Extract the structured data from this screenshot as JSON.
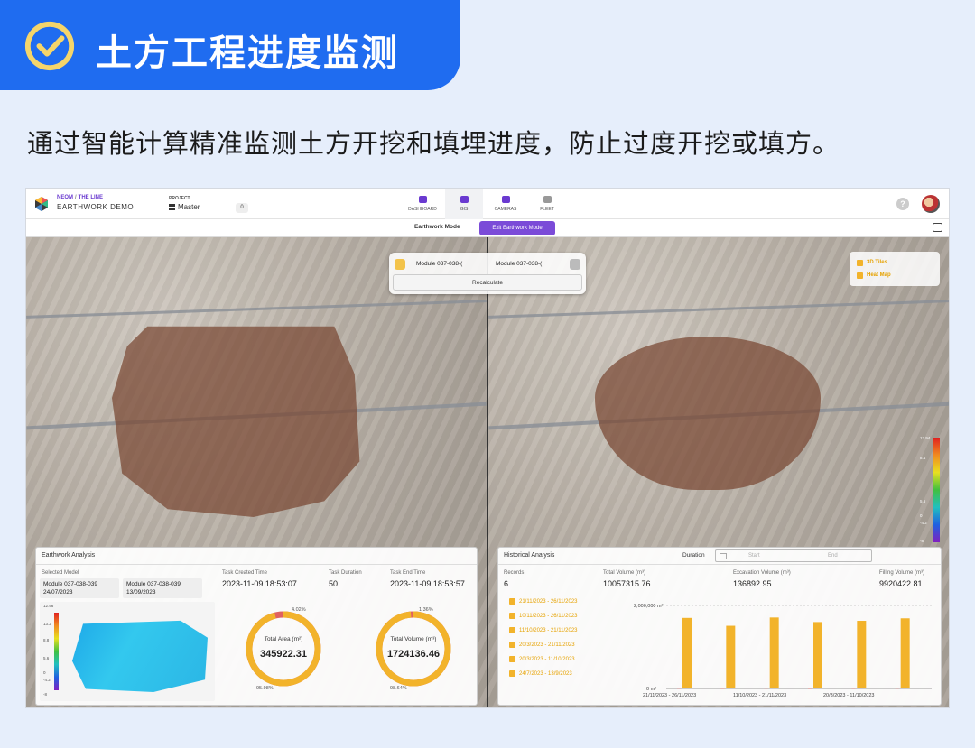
{
  "banner": {
    "title": "土方工程进度监测"
  },
  "subtitle": "通过智能计算精准监测土方开挖和填埋进度，防止过度开挖或填方。",
  "header": {
    "org": "NEOM",
    "sep": "/",
    "project_line": "THE LINE",
    "app": "EARTHWORK DEMO",
    "project_label": "PROJECT",
    "project_value": "Master",
    "project_count": "0",
    "nav": [
      {
        "label": "DASHBOARD"
      },
      {
        "label": "GIS"
      },
      {
        "label": "CAMERAS"
      },
      {
        "label": "FLEET"
      }
    ],
    "help": "?"
  },
  "modebar": {
    "label": "Earthwork Mode",
    "exit": "Exit Earthwork Mode"
  },
  "map": {
    "select_a": "Module 037-038-(",
    "select_b": "Module 037-038-(",
    "recalculate": "Recalculate",
    "layers": [
      {
        "label": "3D Tiles"
      },
      {
        "label": "Heat Map"
      }
    ],
    "legend_ticks": [
      "13.94",
      "8.4",
      "5.6",
      "0",
      "-4.2",
      "-8"
    ]
  },
  "analysis": {
    "title": "Earthwork Analysis",
    "selected_label": "Selected Model",
    "model_a": {
      "name": "Module 037-038-039",
      "date": "24/07/2023"
    },
    "model_b": {
      "name": "Module 037-038-039",
      "date": "13/09/2023"
    },
    "task_created_label": "Task Created Time",
    "task_created": "2023-11-09 18:53:07",
    "task_duration_label": "Task Duration",
    "task_duration": "50",
    "task_end_label": "Task End Time",
    "task_end": "2023-11-09 18:53:57",
    "thumb_ticks": [
      "12.96",
      "13.2",
      "8.8",
      "5.6",
      "0",
      "-4.2",
      "-8"
    ],
    "area": {
      "label": "Total Area (m²)",
      "value": "345922.31",
      "pct_top": "4.02%",
      "pct_bottom": "95.98%",
      "fraction": 0.9598
    },
    "volume": {
      "label": "Total Volume (m³)",
      "value": "1724136.46",
      "pct_top": "1.36%",
      "pct_bottom": "98.64%",
      "fraction": 0.9864
    }
  },
  "history": {
    "title": "Historical Analysis",
    "duration_label": "Duration",
    "start": "Start",
    "end": "End",
    "records_label": "Records",
    "records": "6",
    "total_vol_label": "Total Volume (m³)",
    "total_vol": "10057315.76",
    "exc_label": "Excavation Volume (m³)",
    "exc": "136892.95",
    "fill_label": "Filling Volume (m³)",
    "fill": "9920422.81",
    "ranges": [
      "21/11/2023 - 26/11/2023",
      "10/11/2023 - 26/11/2023",
      "11/10/2023 - 21/11/2023",
      "20/3/2023 - 21/11/2023",
      "20/3/2023 - 11/10/2023",
      "24/7/2023 - 13/9/2023"
    ]
  },
  "chart_data": {
    "type": "bar",
    "ylim": [
      0,
      2000000
    ],
    "ytick_top": "2,000,000 m³",
    "ytick_bottom": "0 m³",
    "categories": [
      "21/11/2023 - 26/11/2023",
      "10/11/2023 - 26/11/2023",
      "11/10/2023 - 21/11/2023",
      "20/3/2023 - 21/11/2023",
      "20/3/2023 - 11/10/2023",
      "24/7/2023 - 13/9/2023"
    ],
    "xtick_labels": [
      "21/11/2023 - 26/11/2023",
      "11/10/2023 - 21/11/2023",
      "20/3/2023 - 11/10/2023"
    ],
    "series": [
      {
        "values": [
          1700000,
          1510000,
          1710000,
          1600000,
          1630000,
          1690000
        ],
        "color": "#f2b32b"
      },
      {
        "values": [
          12000,
          10000,
          14000,
          9000,
          11000,
          13000
        ],
        "color": "#e06060"
      }
    ]
  },
  "colors": {
    "accent": "#1f6cf0",
    "purple": "#7b4bd8",
    "gold": "#f2b32b"
  }
}
